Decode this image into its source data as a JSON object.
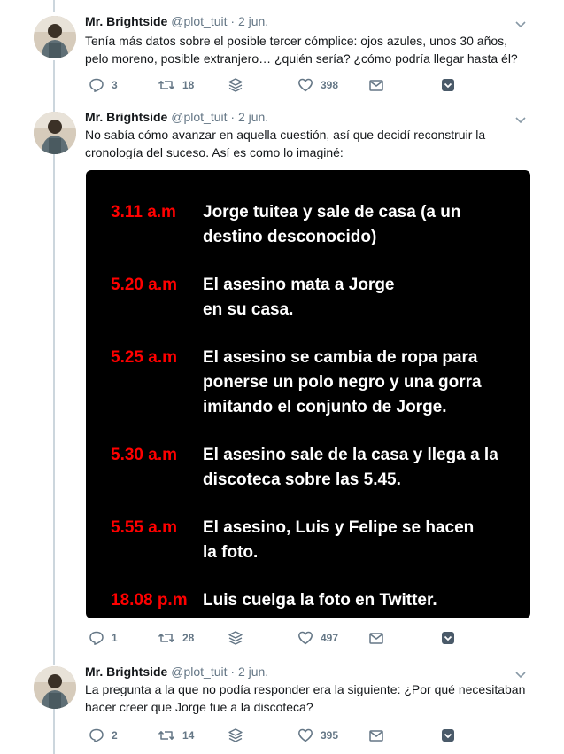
{
  "tweets": [
    {
      "name": "Mr. Brightside",
      "handle": "@plot_tuit",
      "dot": "·",
      "date": "2 jun.",
      "lines": [
        "Tenía más datos sobre el posible tercer cómplice: ojos azules, unos 30 años,",
        "pelo moreno, posible extranjero… ¿quién sería? ¿cómo podría llegar hasta él?"
      ],
      "replies": "3",
      "retweets": "18",
      "likes": "398"
    },
    {
      "name": "Mr. Brightside",
      "handle": "@plot_tuit",
      "dot": "·",
      "date": "2 jun.",
      "lines": [
        "No sabía cómo avanzar en aquella cuestión, así que decidí reconstruir la",
        "cronología del suceso. Así es como lo imaginé:"
      ],
      "replies": "1",
      "retweets": "28",
      "likes": "497",
      "timeline": [
        {
          "time": "3.11 a.m",
          "lines": [
            "Jorge tuitea y sale de casa (a un",
            "destino desconocido)"
          ]
        },
        {
          "time": "5.20 a.m",
          "lines": [
            "El asesino mata a Jorge",
            "en su casa."
          ]
        },
        {
          "time": "5.25 a.m",
          "lines": [
            "El asesino se cambia de ropa para",
            "ponerse un polo negro y una gorra",
            "imitando el conjunto de Jorge."
          ]
        },
        {
          "time": "5.30 a.m",
          "lines": [
            "El asesino sale de la casa y llega a la",
            "discoteca sobre las 5.45."
          ]
        },
        {
          "time": "5.55 a.m",
          "lines": [
            "El asesino, Luis y Felipe se hacen",
            "la foto."
          ]
        },
        {
          "time": "18.08 p.m",
          "lines": [
            "Luis cuelga la foto en Twitter."
          ]
        }
      ]
    },
    {
      "name": "Mr. Brightside",
      "handle": "@plot_tuit",
      "dot": "·",
      "date": "2 jun.",
      "lines": [
        "La pregunta a la que no podía responder era la siguiente: ¿Por qué necesitaban",
        "hacer creer que Jorge fue a la discoteca?"
      ],
      "replies": "2",
      "retweets": "14",
      "likes": "395"
    }
  ],
  "colors": {
    "text": "#14171a",
    "muted": "#657786",
    "thread": "#ccd6dd",
    "timeline_time": "#ff0000",
    "timeline_bg": "#000000"
  },
  "icons": [
    "avatar",
    "chevron-down-icon",
    "reply-icon",
    "retweet-icon",
    "stack-icon",
    "like-icon",
    "dm-icon",
    "share-icon"
  ]
}
